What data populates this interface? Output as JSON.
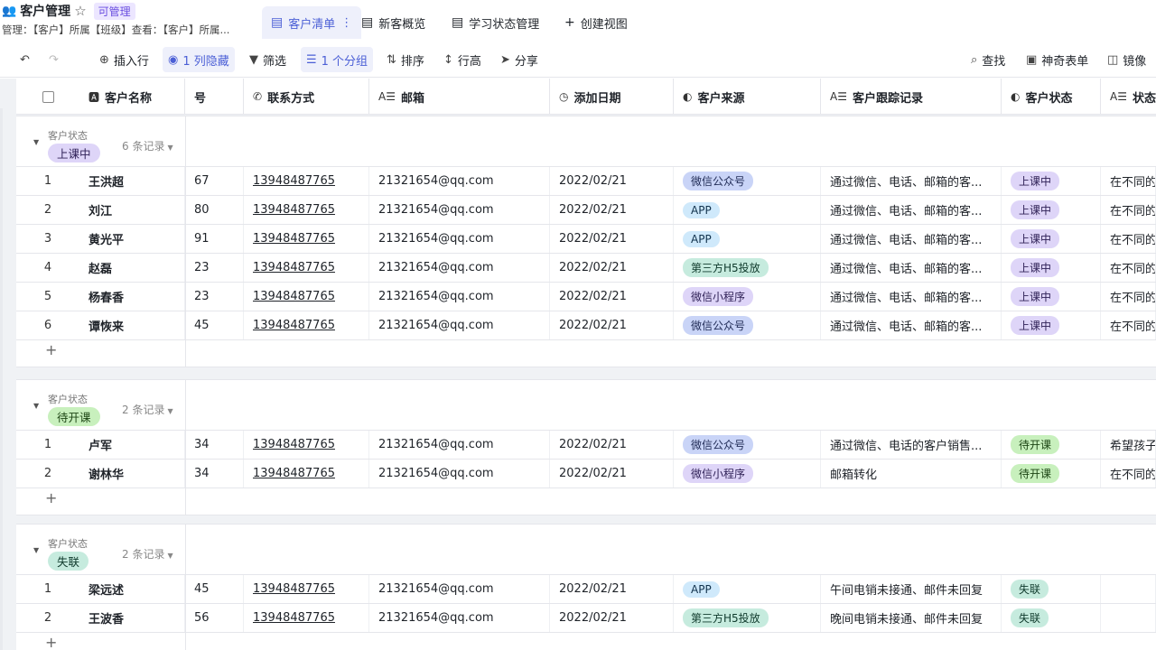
{
  "app": {
    "title": "客户管理",
    "permission_badge": "可管理",
    "permission_desc": "管理：【客户】所属【班级】查看：【客户】所属..."
  },
  "view_tabs": [
    {
      "label": "客户清单",
      "more": "⋮",
      "icon": "grid-icon"
    },
    {
      "label": "新客概览",
      "icon": "grid-icon"
    },
    {
      "label": "学习状态管理",
      "icon": "grid-icon"
    },
    {
      "label": "创建视图",
      "icon": "plus-icon"
    }
  ],
  "toolbar": {
    "insert_row": "插入行",
    "hidden_cols": "1 列隐藏",
    "filter": "筛选",
    "group": "1 个分组",
    "sort": "排序",
    "row_height": "行高",
    "share": "分享",
    "find": "查找",
    "magic_form": "神奇表单",
    "mirror": "镜像"
  },
  "columns": {
    "name": "客户名称",
    "id_partial": "号",
    "contact": "联系方式",
    "email": "邮箱",
    "date": "添加日期",
    "source": "客户来源",
    "tracking": "客户跟踪记录",
    "status": "客户状态",
    "status_note": "状态备"
  },
  "groups": [
    {
      "field": "客户状态",
      "value": "上课中",
      "count": "6 条记录",
      "rows": [
        {
          "n": "1",
          "name": "王洪超",
          "idp": "67",
          "phone": "13948487765",
          "email": "21321654@qq.com",
          "date": "2022/02/21",
          "source": "微信公众号",
          "track": "通过微信、电话、邮箱的客...",
          "status": "上课中",
          "note": "在不同的"
        },
        {
          "n": "2",
          "name": "刘江",
          "idp": "80",
          "phone": "13948487765",
          "email": "21321654@qq.com",
          "date": "2022/02/21",
          "source": "APP",
          "track": "通过微信、电话、邮箱的客...",
          "status": "上课中",
          "note": "在不同的"
        },
        {
          "n": "3",
          "name": "黄光平",
          "idp": "91",
          "phone": "13948487765",
          "email": "21321654@qq.com",
          "date": "2022/02/21",
          "source": "APP",
          "track": "通过微信、电话、邮箱的客...",
          "status": "上课中",
          "note": "在不同的"
        },
        {
          "n": "4",
          "name": "赵磊",
          "idp": "23",
          "phone": "13948487765",
          "email": "21321654@qq.com",
          "date": "2022/02/21",
          "source": "第三方H5投放",
          "track": "通过微信、电话、邮箱的客...",
          "status": "上课中",
          "note": "在不同的"
        },
        {
          "n": "5",
          "name": "杨春香",
          "idp": "23",
          "phone": "13948487765",
          "email": "21321654@qq.com",
          "date": "2022/02/21",
          "source": "微信小程序",
          "track": "通过微信、电话、邮箱的客...",
          "status": "上课中",
          "note": "在不同的"
        },
        {
          "n": "6",
          "name": "谭恢来",
          "idp": "45",
          "phone": "13948487765",
          "email": "21321654@qq.com",
          "date": "2022/02/21",
          "source": "微信公众号",
          "track": "通过微信、电话、邮箱的客...",
          "status": "上课中",
          "note": "在不同的"
        }
      ]
    },
    {
      "field": "客户状态",
      "value": "待开课",
      "count": "2 条记录",
      "rows": [
        {
          "n": "1",
          "name": "卢军",
          "idp": "34",
          "phone": "13948487765",
          "email": "21321654@qq.com",
          "date": "2022/02/21",
          "source": "微信公众号",
          "track": "通过微信、电话的客户销售...",
          "status": "待开课",
          "note": "希望孩子"
        },
        {
          "n": "2",
          "name": "谢林华",
          "idp": "34",
          "phone": "13948487765",
          "email": "21321654@qq.com",
          "date": "2022/02/21",
          "source": "微信小程序",
          "track": "邮箱转化",
          "status": "待开课",
          "note": "在不同的"
        }
      ]
    },
    {
      "field": "客户状态",
      "value": "失联",
      "count": "2 条记录",
      "rows": [
        {
          "n": "1",
          "name": "梁远述",
          "idp": "45",
          "phone": "13948487765",
          "email": "21321654@qq.com",
          "date": "2022/02/21",
          "source": "APP",
          "track": "午间电销未接通、邮件未回复",
          "status": "失联",
          "note": ""
        },
        {
          "n": "2",
          "name": "王波香",
          "idp": "56",
          "phone": "13948487765",
          "email": "21321654@qq.com",
          "date": "2022/02/21",
          "source": "第三方H5投放",
          "track": "晚间电销未接通、邮件未回复",
          "status": "失联",
          "note": ""
        }
      ]
    }
  ],
  "add_row_symbol": "+"
}
